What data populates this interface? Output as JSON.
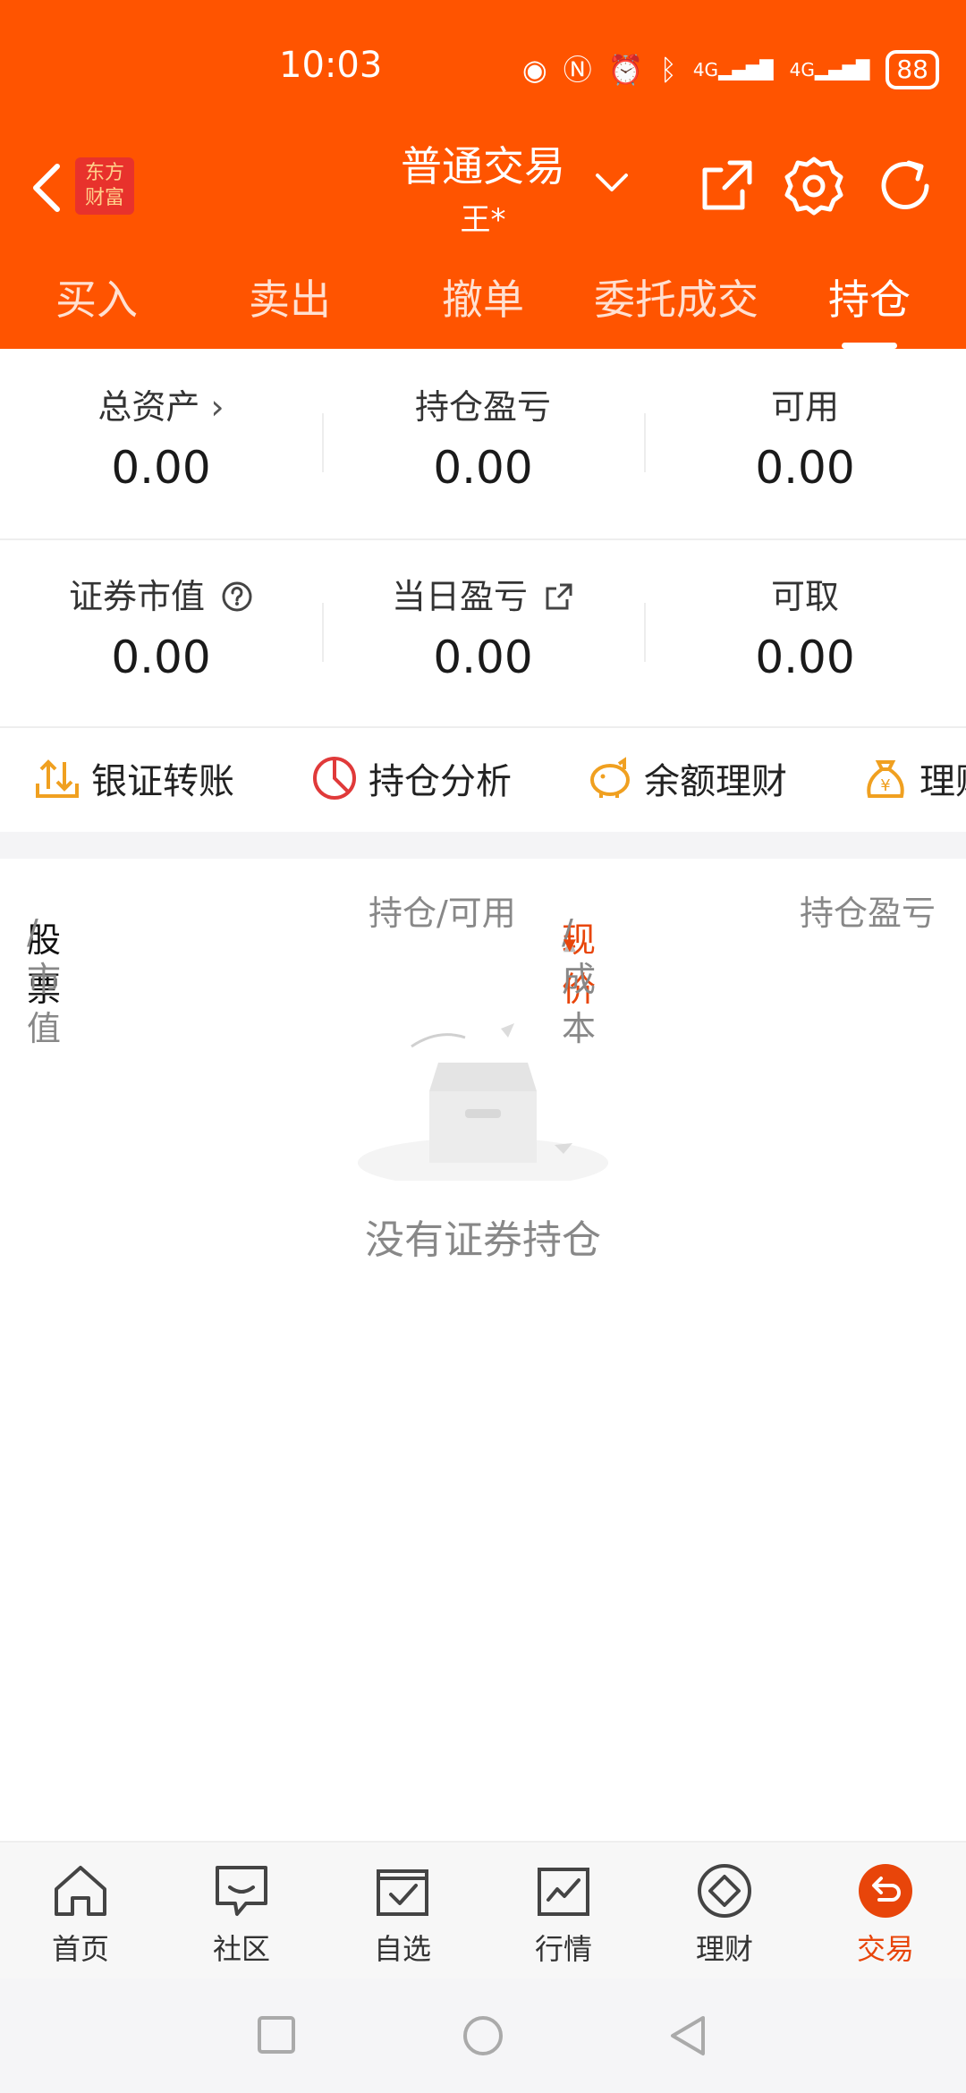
{
  "status_bar": {
    "time": "10:03",
    "battery": "88",
    "network_1": "4G",
    "network_2": "4G"
  },
  "header": {
    "brand_line1": "东方",
    "brand_line2": "财富",
    "title": "普通交易",
    "account": "王*",
    "tabs": [
      "买入",
      "卖出",
      "撤单",
      "委托成交",
      "持仓"
    ],
    "active_tab": "持仓"
  },
  "stats": {
    "total_assets_label": "总资产",
    "total_assets": "0.00",
    "position_pnl_label": "持仓盈亏",
    "position_pnl": "0.00",
    "available_label": "可用",
    "available": "0.00",
    "market_value_label": "证券市值",
    "market_value": "0.00",
    "daily_pnl_label": "当日盈亏",
    "daily_pnl": "0.00",
    "withdrawable_label": "可取",
    "withdrawable": "0.00"
  },
  "quick_actions": [
    "银证转账",
    "持仓分析",
    "余额理财",
    "理财"
  ],
  "columns": {
    "stock": "股票",
    "stock_sub": "/市值",
    "position": "持仓/可用",
    "price": "现价",
    "price_sub": "/成本",
    "pnl": "持仓盈亏"
  },
  "empty_message": "没有证券持仓",
  "bottom_nav": [
    "首页",
    "社区",
    "自选",
    "行情",
    "理财",
    "交易"
  ],
  "active_nav": "交易",
  "colors": {
    "brand": "#FF5400",
    "accent_text": "#E8450A"
  }
}
